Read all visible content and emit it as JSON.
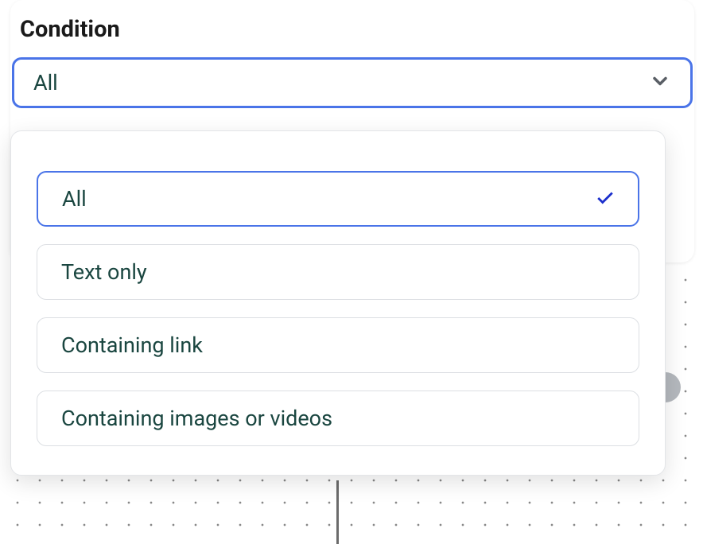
{
  "label": "Condition",
  "select": {
    "value": "All"
  },
  "options": [
    {
      "label": "All",
      "selected": true
    },
    {
      "label": "Text only",
      "selected": false
    },
    {
      "label": "Containing link",
      "selected": false
    },
    {
      "label": "Containing images or videos",
      "selected": false
    }
  ]
}
